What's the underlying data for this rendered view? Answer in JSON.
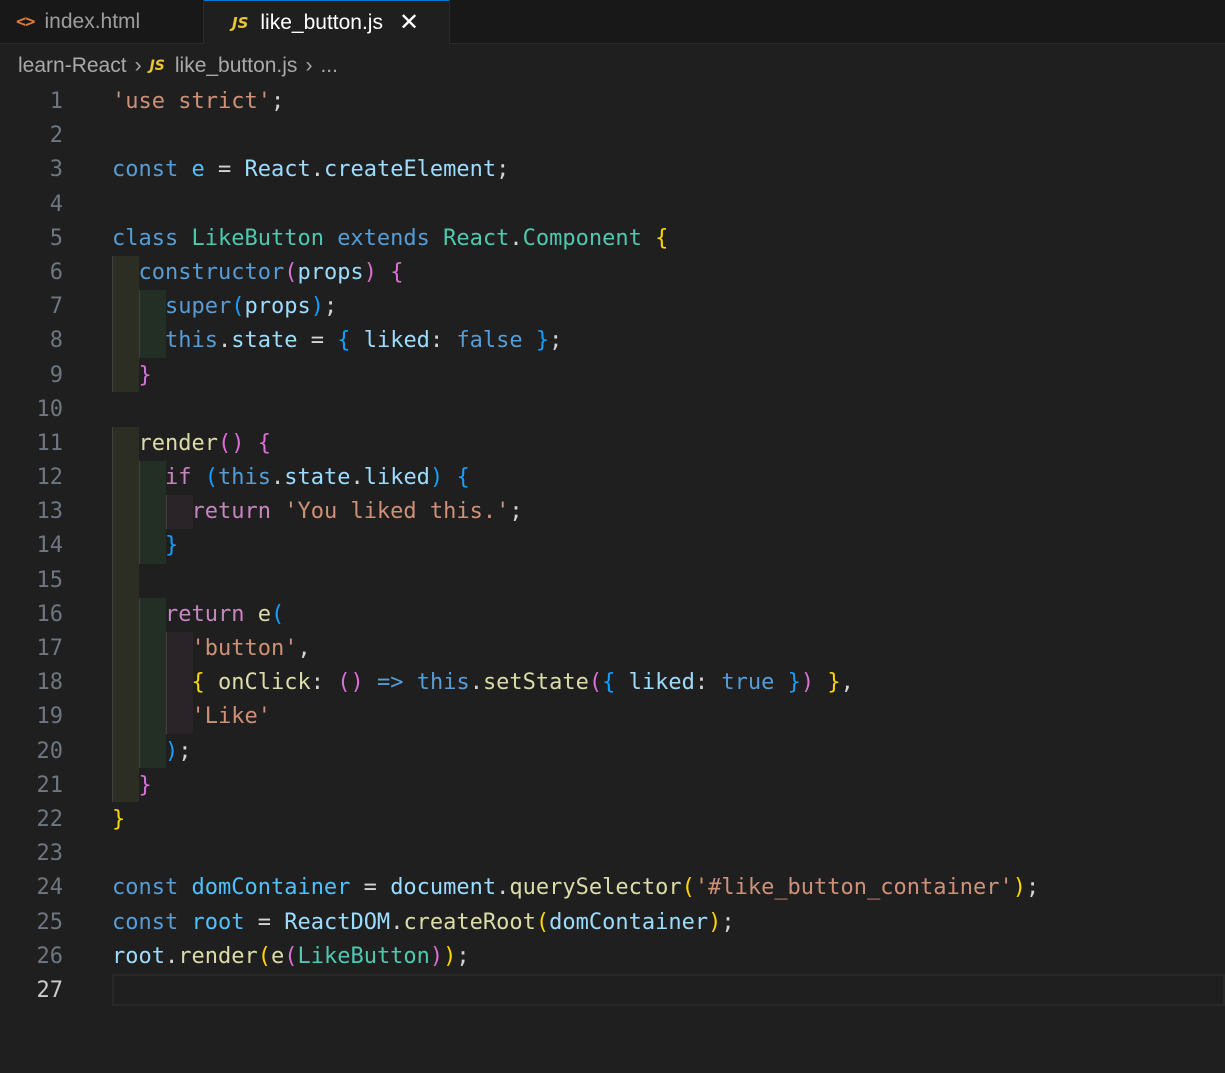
{
  "tabs": [
    {
      "label": "index.html",
      "icon": "html-file-icon",
      "active": false
    },
    {
      "label": "like_button.js",
      "icon": "js-file-icon",
      "active": true
    }
  ],
  "tab_icons": {
    "html_glyph": "<>",
    "js_glyph": "JS",
    "close_glyph": "✕"
  },
  "breadcrumb": {
    "folder": "learn-React",
    "file": "like_button.js",
    "more": "...",
    "separator": "›"
  },
  "editor": {
    "current_line": 27,
    "line_numbers": [
      "1",
      "2",
      "3",
      "4",
      "5",
      "6",
      "7",
      "8",
      "9",
      "10",
      "11",
      "12",
      "13",
      "14",
      "15",
      "16",
      "17",
      "18",
      "19",
      "20",
      "21",
      "22",
      "23",
      "24",
      "25",
      "26",
      "27"
    ],
    "lines": [
      [
        {
          "t": "'use strict'",
          "c": "t-str"
        },
        {
          "t": ";",
          "c": "t-p"
        }
      ],
      [],
      [
        {
          "t": "const",
          "c": "t-kw"
        },
        {
          "t": " ",
          "c": "t-p"
        },
        {
          "t": "e",
          "c": "t-var2"
        },
        {
          "t": " = ",
          "c": "t-p"
        },
        {
          "t": "React",
          "c": "t-var"
        },
        {
          "t": ".",
          "c": "t-p"
        },
        {
          "t": "createElement",
          "c": "t-var"
        },
        {
          "t": ";",
          "c": "t-p"
        }
      ],
      [],
      [
        {
          "t": "class",
          "c": "t-kw"
        },
        {
          "t": " ",
          "c": "t-p"
        },
        {
          "t": "LikeButton",
          "c": "t-cls"
        },
        {
          "t": " ",
          "c": "t-p"
        },
        {
          "t": "extends",
          "c": "t-kw"
        },
        {
          "t": " ",
          "c": "t-p"
        },
        {
          "t": "React",
          "c": "t-cls"
        },
        {
          "t": ".",
          "c": "t-p"
        },
        {
          "t": "Component",
          "c": "t-cls"
        },
        {
          "t": " ",
          "c": "t-p"
        },
        {
          "t": "{",
          "c": "b1"
        }
      ],
      [
        {
          "t": "  ",
          "c": "t-p"
        },
        {
          "t": "constructor",
          "c": "t-kw"
        },
        {
          "t": "(",
          "c": "b2"
        },
        {
          "t": "props",
          "c": "t-var"
        },
        {
          "t": ")",
          "c": "b2"
        },
        {
          "t": " ",
          "c": "t-p"
        },
        {
          "t": "{",
          "c": "b2"
        }
      ],
      [
        {
          "t": "    ",
          "c": "t-p"
        },
        {
          "t": "super",
          "c": "t-kw"
        },
        {
          "t": "(",
          "c": "b3"
        },
        {
          "t": "props",
          "c": "t-var"
        },
        {
          "t": ")",
          "c": "b3"
        },
        {
          "t": ";",
          "c": "t-p"
        }
      ],
      [
        {
          "t": "    ",
          "c": "t-p"
        },
        {
          "t": "this",
          "c": "t-kw"
        },
        {
          "t": ".",
          "c": "t-p"
        },
        {
          "t": "state",
          "c": "t-var"
        },
        {
          "t": " = ",
          "c": "t-p"
        },
        {
          "t": "{",
          "c": "b3"
        },
        {
          "t": " ",
          "c": "t-p"
        },
        {
          "t": "liked",
          "c": "t-var"
        },
        {
          "t": ": ",
          "c": "t-p"
        },
        {
          "t": "false",
          "c": "t-kw"
        },
        {
          "t": " ",
          "c": "t-p"
        },
        {
          "t": "}",
          "c": "b3"
        },
        {
          "t": ";",
          "c": "t-p"
        }
      ],
      [
        {
          "t": "  ",
          "c": "t-p"
        },
        {
          "t": "}",
          "c": "b2"
        }
      ],
      [],
      [
        {
          "t": "  ",
          "c": "t-p"
        },
        {
          "t": "render",
          "c": "t-fn"
        },
        {
          "t": "()",
          "c": "b2"
        },
        {
          "t": " ",
          "c": "t-p"
        },
        {
          "t": "{",
          "c": "b2"
        }
      ],
      [
        {
          "t": "    ",
          "c": "t-p"
        },
        {
          "t": "if",
          "c": "t-ctrl"
        },
        {
          "t": " ",
          "c": "t-p"
        },
        {
          "t": "(",
          "c": "b3"
        },
        {
          "t": "this",
          "c": "t-kw"
        },
        {
          "t": ".",
          "c": "t-p"
        },
        {
          "t": "state",
          "c": "t-var"
        },
        {
          "t": ".",
          "c": "t-p"
        },
        {
          "t": "liked",
          "c": "t-var"
        },
        {
          "t": ")",
          "c": "b3"
        },
        {
          "t": " ",
          "c": "t-p"
        },
        {
          "t": "{",
          "c": "b3"
        }
      ],
      [
        {
          "t": "      ",
          "c": "t-p"
        },
        {
          "t": "return",
          "c": "t-ctrl"
        },
        {
          "t": " ",
          "c": "t-p"
        },
        {
          "t": "'You liked this.'",
          "c": "t-str"
        },
        {
          "t": ";",
          "c": "t-p"
        }
      ],
      [
        {
          "t": "    ",
          "c": "t-p"
        },
        {
          "t": "}",
          "c": "b3"
        }
      ],
      [],
      [
        {
          "t": "    ",
          "c": "t-p"
        },
        {
          "t": "return",
          "c": "t-ctrl"
        },
        {
          "t": " ",
          "c": "t-p"
        },
        {
          "t": "e",
          "c": "t-fn"
        },
        {
          "t": "(",
          "c": "b3"
        }
      ],
      [
        {
          "t": "      ",
          "c": "t-p"
        },
        {
          "t": "'button'",
          "c": "t-str"
        },
        {
          "t": ",",
          "c": "t-p"
        }
      ],
      [
        {
          "t": "      ",
          "c": "t-p"
        },
        {
          "t": "{",
          "c": "b1"
        },
        {
          "t": " ",
          "c": "t-p"
        },
        {
          "t": "onClick",
          "c": "t-fn"
        },
        {
          "t": ": ",
          "c": "t-p"
        },
        {
          "t": "()",
          "c": "b2"
        },
        {
          "t": " ",
          "c": "t-p"
        },
        {
          "t": "=>",
          "c": "t-kw"
        },
        {
          "t": " ",
          "c": "t-p"
        },
        {
          "t": "this",
          "c": "t-kw"
        },
        {
          "t": ".",
          "c": "t-p"
        },
        {
          "t": "setState",
          "c": "t-fn"
        },
        {
          "t": "(",
          "c": "b2"
        },
        {
          "t": "{",
          "c": "b3"
        },
        {
          "t": " ",
          "c": "t-p"
        },
        {
          "t": "liked",
          "c": "t-var"
        },
        {
          "t": ": ",
          "c": "t-p"
        },
        {
          "t": "true",
          "c": "t-kw"
        },
        {
          "t": " ",
          "c": "t-p"
        },
        {
          "t": "}",
          "c": "b3"
        },
        {
          "t": ")",
          "c": "b2"
        },
        {
          "t": " ",
          "c": "t-p"
        },
        {
          "t": "}",
          "c": "b1"
        },
        {
          "t": ",",
          "c": "t-p"
        }
      ],
      [
        {
          "t": "      ",
          "c": "t-p"
        },
        {
          "t": "'Like'",
          "c": "t-str"
        }
      ],
      [
        {
          "t": "    ",
          "c": "t-p"
        },
        {
          "t": ")",
          "c": "b3"
        },
        {
          "t": ";",
          "c": "t-p"
        }
      ],
      [
        {
          "t": "  ",
          "c": "t-p"
        },
        {
          "t": "}",
          "c": "b2"
        }
      ],
      [
        {
          "t": "}",
          "c": "b1"
        }
      ],
      [],
      [
        {
          "t": "const",
          "c": "t-kw"
        },
        {
          "t": " ",
          "c": "t-p"
        },
        {
          "t": "domContainer",
          "c": "t-var2"
        },
        {
          "t": " = ",
          "c": "t-p"
        },
        {
          "t": "document",
          "c": "t-var"
        },
        {
          "t": ".",
          "c": "t-p"
        },
        {
          "t": "querySelector",
          "c": "t-fn"
        },
        {
          "t": "(",
          "c": "b1"
        },
        {
          "t": "'#like_button_container'",
          "c": "t-str"
        },
        {
          "t": ")",
          "c": "b1"
        },
        {
          "t": ";",
          "c": "t-p"
        }
      ],
      [
        {
          "t": "const",
          "c": "t-kw"
        },
        {
          "t": " ",
          "c": "t-p"
        },
        {
          "t": "root",
          "c": "t-var2"
        },
        {
          "t": " = ",
          "c": "t-p"
        },
        {
          "t": "ReactDOM",
          "c": "t-var"
        },
        {
          "t": ".",
          "c": "t-p"
        },
        {
          "t": "createRoot",
          "c": "t-fn"
        },
        {
          "t": "(",
          "c": "b1"
        },
        {
          "t": "domContainer",
          "c": "t-var"
        },
        {
          "t": ")",
          "c": "b1"
        },
        {
          "t": ";",
          "c": "t-p"
        }
      ],
      [
        {
          "t": "root",
          "c": "t-var"
        },
        {
          "t": ".",
          "c": "t-p"
        },
        {
          "t": "render",
          "c": "t-fn"
        },
        {
          "t": "(",
          "c": "b1"
        },
        {
          "t": "e",
          "c": "t-fn"
        },
        {
          "t": "(",
          "c": "b2"
        },
        {
          "t": "LikeButton",
          "c": "t-cls"
        },
        {
          "t": ")",
          "c": "b2"
        },
        {
          "t": ")",
          "c": "b1"
        },
        {
          "t": ";",
          "c": "t-p"
        }
      ],
      []
    ]
  }
}
